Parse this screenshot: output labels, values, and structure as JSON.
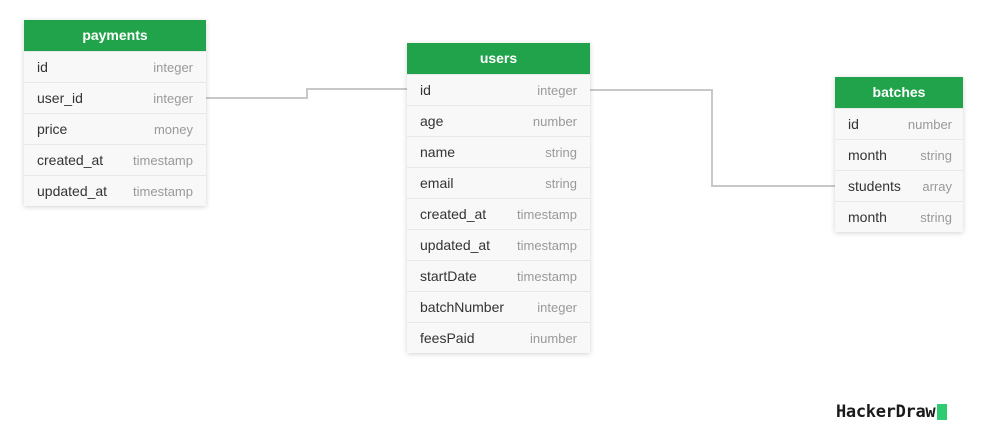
{
  "colors": {
    "header": "#20a34a",
    "connector": "#c8c8c8",
    "brand_block": "#2ecc71"
  },
  "tables": {
    "payments": {
      "title": "payments",
      "columns": [
        {
          "name": "id",
          "type": "integer"
        },
        {
          "name": "user_id",
          "type": "integer"
        },
        {
          "name": "price",
          "type": "money"
        },
        {
          "name": "created_at",
          "type": "timestamp"
        },
        {
          "name": "updated_at",
          "type": "timestamp"
        }
      ]
    },
    "users": {
      "title": "users",
      "columns": [
        {
          "name": "id",
          "type": "integer"
        },
        {
          "name": "age",
          "type": "number"
        },
        {
          "name": "name",
          "type": "string"
        },
        {
          "name": "email",
          "type": "string"
        },
        {
          "name": "created_at",
          "type": "timestamp"
        },
        {
          "name": "updated_at",
          "type": "timestamp"
        },
        {
          "name": "startDate",
          "type": "timestamp"
        },
        {
          "name": "batchNumber",
          "type": "integer"
        },
        {
          "name": "feesPaid",
          "type": "inumber"
        }
      ]
    },
    "batches": {
      "title": "batches",
      "columns": [
        {
          "name": "id",
          "type": "number"
        },
        {
          "name": "month",
          "type": "string"
        },
        {
          "name": "students",
          "type": "array"
        },
        {
          "name": "month",
          "type": "string"
        }
      ]
    }
  },
  "relations": [
    {
      "from": "payments.user_id",
      "to": "users.id"
    },
    {
      "from": "users.id",
      "to": "batches.students"
    }
  ],
  "brand": {
    "name": "HackerDraw"
  }
}
